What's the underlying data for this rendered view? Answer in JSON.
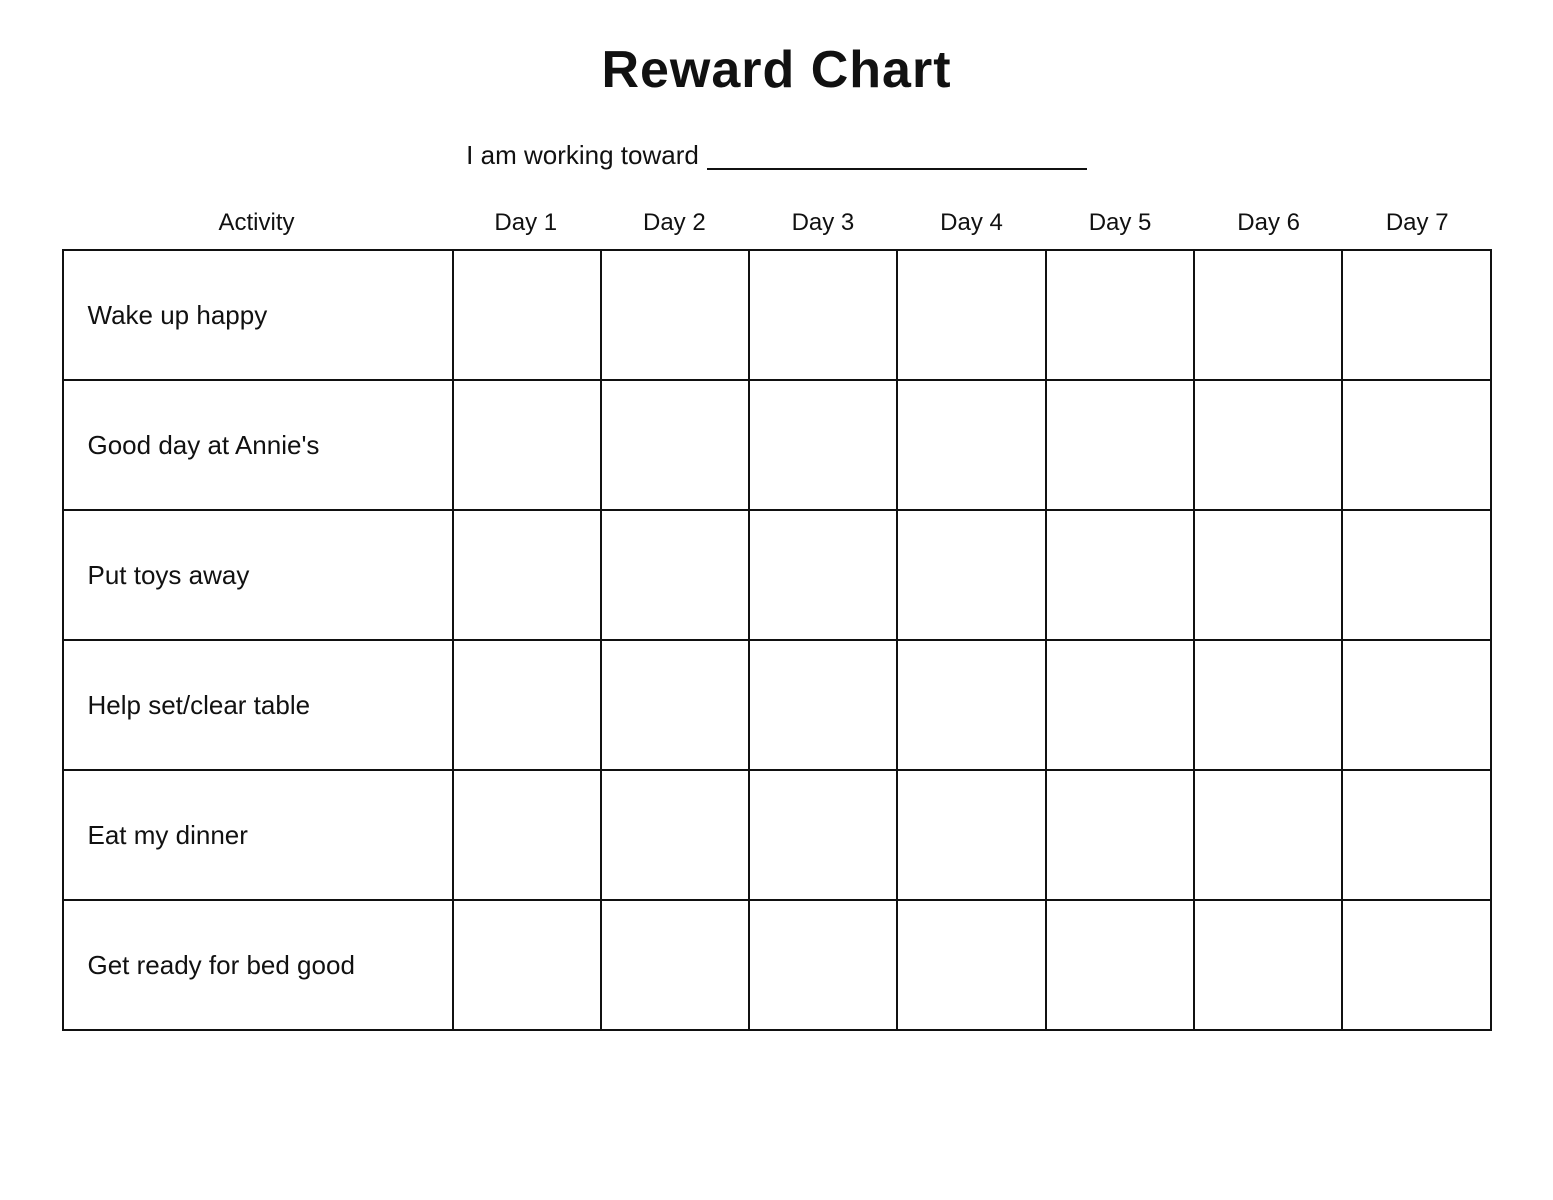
{
  "title": "Reward Chart",
  "subtitle": "I am working toward",
  "header": {
    "activity_col": "Activity",
    "days": [
      "Day 1",
      "Day 2",
      "Day 3",
      "Day 4",
      "Day 5",
      "Day 6",
      "Day 7"
    ]
  },
  "rows": [
    {
      "activity": "Wake up happy"
    },
    {
      "activity": "Good day at Annie's"
    },
    {
      "activity": "Put toys away"
    },
    {
      "activity": "Help set/clear table"
    },
    {
      "activity": "Eat my dinner"
    },
    {
      "activity": "Get ready for bed good"
    }
  ]
}
